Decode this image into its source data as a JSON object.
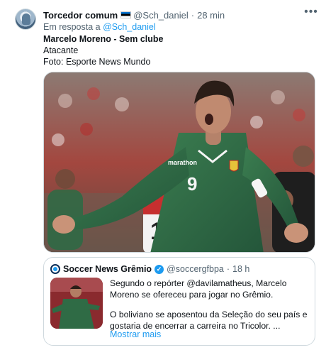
{
  "tweet": {
    "author_name": "Torcedor comum",
    "author_handle": "@Sch_daniel",
    "separator": "·",
    "time": "28 min",
    "reply_prefix": "Em resposta a",
    "reply_handle": "@Sch_daniel",
    "lines": {
      "title": "Marcelo Moreno - Sem clube",
      "position": "Atacante",
      "photo_credit": "Foto: Esporte News Mundo"
    },
    "more_icon": "more-horizontal-icon",
    "media_shirt_number": "9",
    "media_shirt_brand": "marathon",
    "media_bg_number": "10"
  },
  "quote": {
    "name": "Soccer News Grêmio",
    "handle": "@soccergfbpa",
    "separator": "·",
    "time": "18 h",
    "paragraph1": "Segundo o repórter @davilamatheus, Marcelo Moreno se ofereceu para jogar no Grêmio.",
    "paragraph2": "O boliviano se aposentou da Seleção do seu país e gostaria de encerrar a carreira no Tricolor. ...",
    "show_more": "Mostrar mais",
    "verified_icon": "verified-badge-icon"
  },
  "colors": {
    "link": "#1d9bf0",
    "secondary_text": "#536471",
    "border": "#cfd9de",
    "jersey_green": "#2f6b45"
  }
}
